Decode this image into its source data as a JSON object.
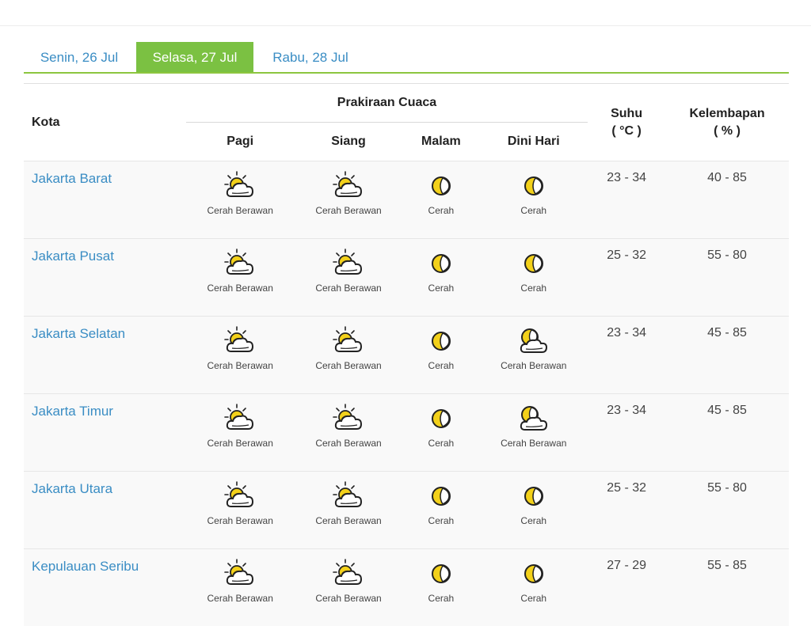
{
  "tabs": [
    {
      "label": "Senin, 26 Jul",
      "active": false
    },
    {
      "label": "Selasa, 27 Jul",
      "active": true
    },
    {
      "label": "Rabu, 28 Jul",
      "active": false
    }
  ],
  "table": {
    "headers": {
      "kota": "Kota",
      "group": "Prakiraan Cuaca",
      "pagi": "Pagi",
      "siang": "Siang",
      "malam": "Malam",
      "dini_hari": "Dini Hari",
      "suhu": "Suhu",
      "suhu_unit": "( °C )",
      "kelembapan": "Kelembapan",
      "kelembapan_unit": "( % )"
    },
    "rows": [
      {
        "city": "Jakarta Barat",
        "pagi": {
          "label": "Cerah Berawan",
          "icon": "partly-cloudy-day-icon"
        },
        "siang": {
          "label": "Cerah Berawan",
          "icon": "partly-cloudy-day-icon"
        },
        "malam": {
          "label": "Cerah",
          "icon": "moon-icon"
        },
        "dini": {
          "label": "Cerah",
          "icon": "moon-icon"
        },
        "suhu": "23 - 34",
        "kelembapan": "40 - 85"
      },
      {
        "city": "Jakarta Pusat",
        "pagi": {
          "label": "Cerah Berawan",
          "icon": "partly-cloudy-day-icon"
        },
        "siang": {
          "label": "Cerah Berawan",
          "icon": "partly-cloudy-day-icon"
        },
        "malam": {
          "label": "Cerah",
          "icon": "moon-icon"
        },
        "dini": {
          "label": "Cerah",
          "icon": "moon-icon"
        },
        "suhu": "25 - 32",
        "kelembapan": "55 - 80"
      },
      {
        "city": "Jakarta Selatan",
        "pagi": {
          "label": "Cerah Berawan",
          "icon": "partly-cloudy-day-icon"
        },
        "siang": {
          "label": "Cerah Berawan",
          "icon": "partly-cloudy-day-icon"
        },
        "malam": {
          "label": "Cerah",
          "icon": "moon-icon"
        },
        "dini": {
          "label": "Cerah Berawan",
          "icon": "partly-cloudy-night-icon"
        },
        "suhu": "23 - 34",
        "kelembapan": "45 - 85"
      },
      {
        "city": "Jakarta Timur",
        "pagi": {
          "label": "Cerah Berawan",
          "icon": "partly-cloudy-day-icon"
        },
        "siang": {
          "label": "Cerah Berawan",
          "icon": "partly-cloudy-day-icon"
        },
        "malam": {
          "label": "Cerah",
          "icon": "moon-icon"
        },
        "dini": {
          "label": "Cerah Berawan",
          "icon": "partly-cloudy-night-icon"
        },
        "suhu": "23 - 34",
        "kelembapan": "45 - 85"
      },
      {
        "city": "Jakarta Utara",
        "pagi": {
          "label": "Cerah Berawan",
          "icon": "partly-cloudy-day-icon"
        },
        "siang": {
          "label": "Cerah Berawan",
          "icon": "partly-cloudy-day-icon"
        },
        "malam": {
          "label": "Cerah",
          "icon": "moon-icon"
        },
        "dini": {
          "label": "Cerah",
          "icon": "moon-icon"
        },
        "suhu": "25 - 32",
        "kelembapan": "55 - 80"
      },
      {
        "city": "Kepulauan Seribu",
        "pagi": {
          "label": "Cerah Berawan",
          "icon": "partly-cloudy-day-icon"
        },
        "siang": {
          "label": "Cerah Berawan",
          "icon": "partly-cloudy-day-icon"
        },
        "malam": {
          "label": "Cerah",
          "icon": "moon-icon"
        },
        "dini": {
          "label": "Cerah",
          "icon": "moon-icon"
        },
        "suhu": "27 - 29",
        "kelembapan": "55 - 85"
      }
    ]
  },
  "colors": {
    "accent_green": "#7bc142",
    "link_blue": "#3a8dc4",
    "sun_yellow": "#f3d11a"
  }
}
